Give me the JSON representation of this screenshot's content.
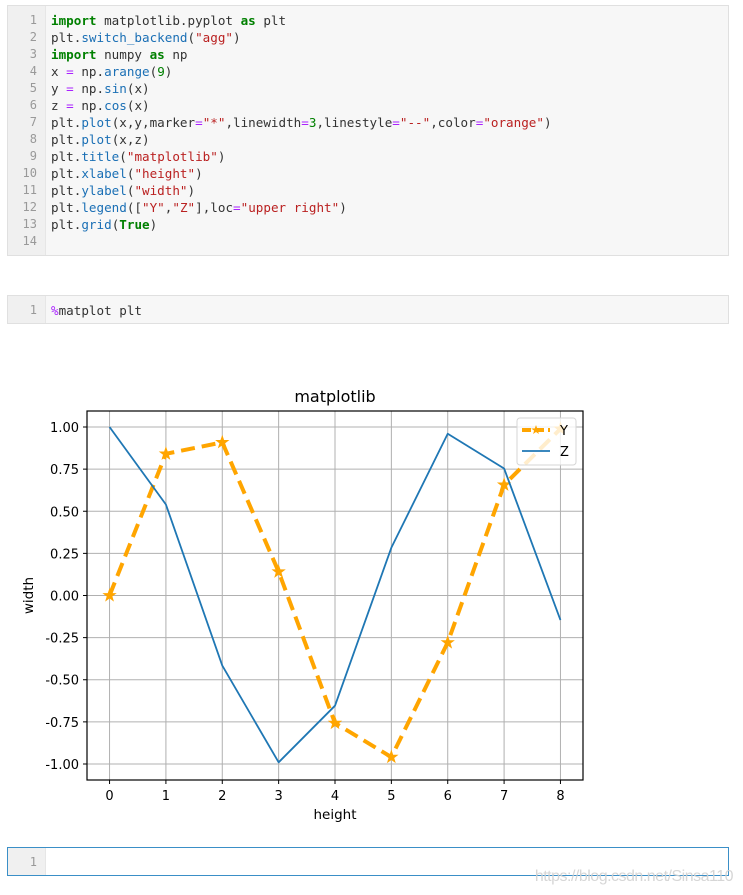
{
  "cells": [
    {
      "type": "code",
      "lines": [
        [
          [
            "kw",
            "import"
          ],
          [
            "t",
            " matplotlib.pyplot "
          ],
          [
            "kw",
            "as"
          ],
          [
            "t",
            " plt"
          ]
        ],
        [
          [
            "t",
            "plt."
          ],
          [
            "fn",
            "switch_backend"
          ],
          [
            "t",
            "("
          ],
          [
            "str",
            "\"agg\""
          ],
          [
            "t",
            ")"
          ]
        ],
        [
          [
            "kw",
            "import"
          ],
          [
            "t",
            " numpy "
          ],
          [
            "kw",
            "as"
          ],
          [
            "t",
            " np"
          ]
        ],
        [
          [
            "t",
            "x "
          ],
          [
            "op",
            "="
          ],
          [
            "t",
            " np."
          ],
          [
            "fn",
            "arange"
          ],
          [
            "t",
            "("
          ],
          [
            "num",
            "9"
          ],
          [
            "t",
            ")"
          ]
        ],
        [
          [
            "t",
            "y "
          ],
          [
            "op",
            "="
          ],
          [
            "t",
            " np."
          ],
          [
            "fn",
            "sin"
          ],
          [
            "t",
            "(x)"
          ]
        ],
        [
          [
            "t",
            "z "
          ],
          [
            "op",
            "="
          ],
          [
            "t",
            " np."
          ],
          [
            "fn",
            "cos"
          ],
          [
            "t",
            "(x)"
          ]
        ],
        [
          [
            "t",
            "plt."
          ],
          [
            "fn",
            "plot"
          ],
          [
            "t",
            "(x,y,marker"
          ],
          [
            "op",
            "="
          ],
          [
            "str",
            "\"*\""
          ],
          [
            "t",
            ",linewidth"
          ],
          [
            "op",
            "="
          ],
          [
            "num",
            "3"
          ],
          [
            "t",
            ",linestyle"
          ],
          [
            "op",
            "="
          ],
          [
            "str",
            "\"--\""
          ],
          [
            "t",
            ",color"
          ],
          [
            "op",
            "="
          ],
          [
            "str",
            "\"orange\""
          ],
          [
            "t",
            ")"
          ]
        ],
        [
          [
            "t",
            "plt."
          ],
          [
            "fn",
            "plot"
          ],
          [
            "t",
            "(x,z)"
          ]
        ],
        [
          [
            "t",
            "plt."
          ],
          [
            "fn",
            "title"
          ],
          [
            "t",
            "("
          ],
          [
            "str",
            "\"matplotlib\""
          ],
          [
            "t",
            ")"
          ]
        ],
        [
          [
            "t",
            "plt."
          ],
          [
            "fn",
            "xlabel"
          ],
          [
            "t",
            "("
          ],
          [
            "str",
            "\"height\""
          ],
          [
            "t",
            ")"
          ]
        ],
        [
          [
            "t",
            "plt."
          ],
          [
            "fn",
            "ylabel"
          ],
          [
            "t",
            "("
          ],
          [
            "str",
            "\"width\""
          ],
          [
            "t",
            ")"
          ]
        ],
        [
          [
            "t",
            "plt."
          ],
          [
            "fn",
            "legend"
          ],
          [
            "t",
            "(["
          ],
          [
            "str",
            "\"Y\""
          ],
          [
            "t",
            ","
          ],
          [
            "str",
            "\"Z\""
          ],
          [
            "t",
            "],loc"
          ],
          [
            "op",
            "="
          ],
          [
            "str",
            "\"upper right\""
          ],
          [
            "t",
            ")"
          ]
        ],
        [
          [
            "t",
            "plt."
          ],
          [
            "fn",
            "grid"
          ],
          [
            "t",
            "("
          ],
          [
            "kw",
            "True"
          ],
          [
            "t",
            ")"
          ]
        ],
        []
      ]
    },
    {
      "type": "code",
      "lines": [
        [
          [
            "op",
            "%"
          ],
          [
            "t",
            "matplot plt"
          ]
        ]
      ]
    },
    {
      "type": "code-active",
      "lines": [
        []
      ]
    }
  ],
  "chart_data": {
    "type": "line",
    "title": "matplotlib",
    "xlabel": "height",
    "ylabel": "width",
    "x": [
      0,
      1,
      2,
      3,
      4,
      5,
      6,
      7,
      8
    ],
    "xticks": [
      "0",
      "1",
      "2",
      "3",
      "4",
      "5",
      "6",
      "7",
      "8"
    ],
    "yticks": [
      "-1.00",
      "-0.75",
      "-0.50",
      "-0.25",
      "0.00",
      "0.25",
      "0.50",
      "0.75",
      "1.00"
    ],
    "ytick_values": [
      -1.0,
      -0.75,
      -0.5,
      -0.25,
      0.0,
      0.25,
      0.5,
      0.75,
      1.0
    ],
    "xlim": [
      -0.4,
      8.4
    ],
    "ylim": [
      -1.095,
      1.095
    ],
    "grid": true,
    "legend_position": "upper right",
    "series": [
      {
        "name": "Y",
        "color": "#ffa500",
        "style": "dashed",
        "marker": "star",
        "values": [
          0.0,
          0.841,
          0.909,
          0.141,
          -0.757,
          -0.959,
          -0.279,
          0.657,
          0.989
        ]
      },
      {
        "name": "Z",
        "color": "#1f77b4",
        "style": "solid",
        "marker": "none",
        "values": [
          1.0,
          0.54,
          -0.416,
          -0.99,
          -0.654,
          0.284,
          0.96,
          0.754,
          -0.146
        ]
      }
    ]
  },
  "watermark": "https://blog.csdn.net/Sinsa110"
}
